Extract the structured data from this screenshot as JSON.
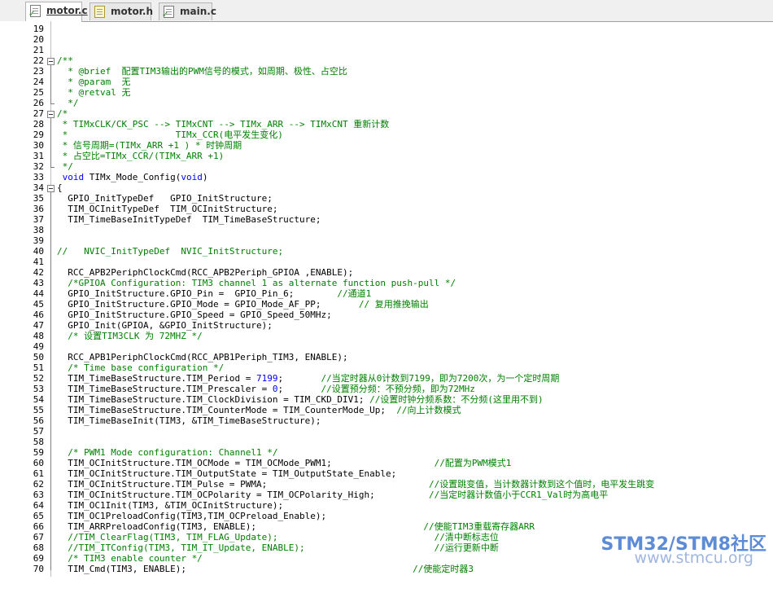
{
  "tabs": [
    {
      "label": "motor.c",
      "active": true,
      "icon": "c-file-icon"
    },
    {
      "label": "motor.h",
      "active": false,
      "icon": "h-file-icon"
    },
    {
      "label": "main.c",
      "active": false,
      "icon": "c-file-icon"
    }
  ],
  "lines": [
    {
      "n": "19",
      "parts": []
    },
    {
      "n": "20",
      "parts": []
    },
    {
      "n": "21",
      "parts": []
    },
    {
      "n": "22",
      "parts": [
        [
          "c",
          "/**"
        ]
      ]
    },
    {
      "n": "23",
      "parts": [
        [
          "c",
          "  * @brief  配置TIM3输出的PWM信号的模式，如周期、极性、占空比"
        ]
      ]
    },
    {
      "n": "24",
      "parts": [
        [
          "c",
          "  * @param  无"
        ]
      ]
    },
    {
      "n": "25",
      "parts": [
        [
          "c",
          "  * @retval 无"
        ]
      ]
    },
    {
      "n": "26",
      "parts": [
        [
          "c",
          "  */"
        ]
      ]
    },
    {
      "n": "27",
      "parts": [
        [
          "c",
          "/*"
        ]
      ]
    },
    {
      "n": "28",
      "parts": [
        [
          "c",
          " * TIMxCLK/CK_PSC --> TIMxCNT --> TIMx_ARR --> TIMxCNT 重新计数"
        ]
      ]
    },
    {
      "n": "29",
      "parts": [
        [
          "c",
          " *                    TIMx_CCR(电平发生变化)"
        ]
      ]
    },
    {
      "n": "30",
      "parts": [
        [
          "c",
          " * 信号周期=(TIMx_ARR +1 ) * 时钟周期"
        ]
      ]
    },
    {
      "n": "31",
      "parts": [
        [
          "c",
          " * 占空比=TIMx_CCR/(TIMx_ARR +1)"
        ]
      ]
    },
    {
      "n": "32",
      "parts": [
        [
          "c",
          " */"
        ]
      ]
    },
    {
      "n": "33",
      "parts": [
        [
          "k",
          " void"
        ],
        [
          "n",
          " TIMx_Mode_Config("
        ],
        [
          "k",
          "void"
        ],
        [
          "n",
          ")"
        ]
      ]
    },
    {
      "n": "34",
      "parts": [
        [
          "n",
          "{"
        ]
      ]
    },
    {
      "n": "35",
      "parts": [
        [
          "n",
          "  GPIO_InitTypeDef   GPIO_InitStructure;"
        ]
      ]
    },
    {
      "n": "36",
      "parts": [
        [
          "n",
          "  TIM_OCInitTypeDef  TIM_OCInitStructure;"
        ]
      ]
    },
    {
      "n": "37",
      "parts": [
        [
          "n",
          "  TIM_TimeBaseInitTypeDef  TIM_TimeBaseStructure;"
        ]
      ]
    },
    {
      "n": "38",
      "parts": []
    },
    {
      "n": "39",
      "parts": []
    },
    {
      "n": "40",
      "parts": [
        [
          "c",
          "//   NVIC_InitTypeDef  NVIC_InitStructure;"
        ]
      ]
    },
    {
      "n": "41",
      "parts": []
    },
    {
      "n": "42",
      "parts": [
        [
          "n",
          "  RCC_APB2PeriphClockCmd(RCC_APB2Periph_GPIOA ,ENABLE);"
        ]
      ]
    },
    {
      "n": "43",
      "parts": [
        [
          "c",
          "  /*GPIOA Configuration: TIM3 channel 1 as alternate function push-pull */"
        ]
      ]
    },
    {
      "n": "44",
      "parts": [
        [
          "n",
          "  GPIO_InitStructure.GPIO_Pin =  GPIO_Pin_6;        "
        ],
        [
          "c",
          "//通道1"
        ]
      ]
    },
    {
      "n": "45",
      "parts": [
        [
          "n",
          "  GPIO_InitStructure.GPIO_Mode = GPIO_Mode_AF_PP;       "
        ],
        [
          "c",
          "// 复用推挽输出"
        ]
      ]
    },
    {
      "n": "46",
      "parts": [
        [
          "n",
          "  GPIO_InitStructure.GPIO_Speed = GPIO_Speed_50MHz;"
        ]
      ]
    },
    {
      "n": "47",
      "parts": [
        [
          "n",
          "  GPIO_Init(GPIOA, &GPIO_InitStructure);"
        ]
      ]
    },
    {
      "n": "48",
      "parts": [
        [
          "c",
          "  /* 设置TIM3CLK 为 72MHZ */"
        ]
      ]
    },
    {
      "n": "49",
      "parts": []
    },
    {
      "n": "50",
      "parts": [
        [
          "n",
          "  RCC_APB1PeriphClockCmd(RCC_APB1Periph_TIM3, ENABLE);"
        ]
      ]
    },
    {
      "n": "51",
      "parts": [
        [
          "c",
          "  /* Time base configuration */"
        ]
      ]
    },
    {
      "n": "52",
      "parts": [
        [
          "n",
          "  TIM_TimeBaseStructure.TIM_Period = "
        ],
        [
          "k",
          "7199"
        ],
        [
          "n",
          ";       "
        ],
        [
          "c",
          "//当定时器从0计数到7199，即为7200次，为一个定时周期"
        ]
      ]
    },
    {
      "n": "53",
      "parts": [
        [
          "n",
          "  TIM_TimeBaseStructure.TIM_Prescaler = "
        ],
        [
          "k",
          "0"
        ],
        [
          "n",
          ";       "
        ],
        [
          "c",
          "//设置预分频：不预分频，即为72MHz"
        ]
      ]
    },
    {
      "n": "54",
      "parts": [
        [
          "n",
          "  TIM_TimeBaseStructure.TIM_ClockDivision = TIM_CKD_DIV1; "
        ],
        [
          "c",
          "//设置时钟分频系数：不分频(这里用不到)"
        ]
      ]
    },
    {
      "n": "55",
      "parts": [
        [
          "n",
          "  TIM_TimeBaseStructure.TIM_CounterMode = TIM_CounterMode_Up;  "
        ],
        [
          "c",
          "//向上计数模式"
        ]
      ]
    },
    {
      "n": "56",
      "parts": [
        [
          "n",
          "  TIM_TimeBaseInit(TIM3, &TIM_TimeBaseStructure);"
        ]
      ]
    },
    {
      "n": "57",
      "parts": []
    },
    {
      "n": "58",
      "parts": []
    },
    {
      "n": "59",
      "parts": [
        [
          "c",
          "  /* PWM1 Mode configuration: Channel1 */"
        ]
      ]
    },
    {
      "n": "60",
      "parts": [
        [
          "n",
          "  TIM_OCInitStructure.TIM_OCMode = TIM_OCMode_PWM1;                   "
        ],
        [
          "c",
          "//配置为PWM模式1"
        ]
      ]
    },
    {
      "n": "61",
      "parts": [
        [
          "n",
          "  TIM_OCInitStructure.TIM_OutputState = TIM_OutputState_Enable;"
        ]
      ]
    },
    {
      "n": "62",
      "parts": [
        [
          "n",
          "  TIM_OCInitStructure.TIM_Pulse = PWMA;                              "
        ],
        [
          "c",
          "//设置跳变值，当计数器计数到这个值时，电平发生跳变"
        ]
      ]
    },
    {
      "n": "63",
      "parts": [
        [
          "n",
          "  TIM_OCInitStructure.TIM_OCPolarity = TIM_OCPolarity_High;          "
        ],
        [
          "c",
          "//当定时器计数值小于CCR1_Val时为高电平"
        ]
      ]
    },
    {
      "n": "64",
      "parts": [
        [
          "n",
          "  TIM_OC1Init(TIM3, &TIM_OCInitStructure);"
        ]
      ]
    },
    {
      "n": "65",
      "parts": [
        [
          "n",
          "  TIM_OC1PreloadConfig(TIM3,TIM_OCPreload_Enable);"
        ]
      ]
    },
    {
      "n": "66",
      "parts": [
        [
          "n",
          "  TIM_ARRPreloadConfig(TIM3, ENABLE);                               "
        ],
        [
          "c",
          "//使能TIM3重载寄存器ARR"
        ]
      ]
    },
    {
      "n": "67",
      "parts": [
        [
          "c",
          "  //TIM_ClearFlag(TIM3, TIM_FLAG_Update);                             //清中断标志位"
        ]
      ]
    },
    {
      "n": "68",
      "parts": [
        [
          "c",
          "  //TIM_ITConfig(TIM3, TIM_IT_Update, ENABLE);                        //运行更新中断"
        ]
      ]
    },
    {
      "n": "69",
      "parts": [
        [
          "c",
          "  /* TIM3 enable counter */"
        ]
      ]
    },
    {
      "n": "70",
      "parts": [
        [
          "n",
          "  TIM_Cmd(TIM3, ENABLE);                                          "
        ],
        [
          "c",
          "//使能定时器3"
        ]
      ]
    }
  ],
  "watermark": {
    "title": "STM32/STM8社区",
    "url": "www.stmcu.org"
  },
  "colors": {
    "keyword": "#0000ff",
    "comment": "#008000",
    "text": "#000000",
    "watermark": "#5d8bd6"
  }
}
